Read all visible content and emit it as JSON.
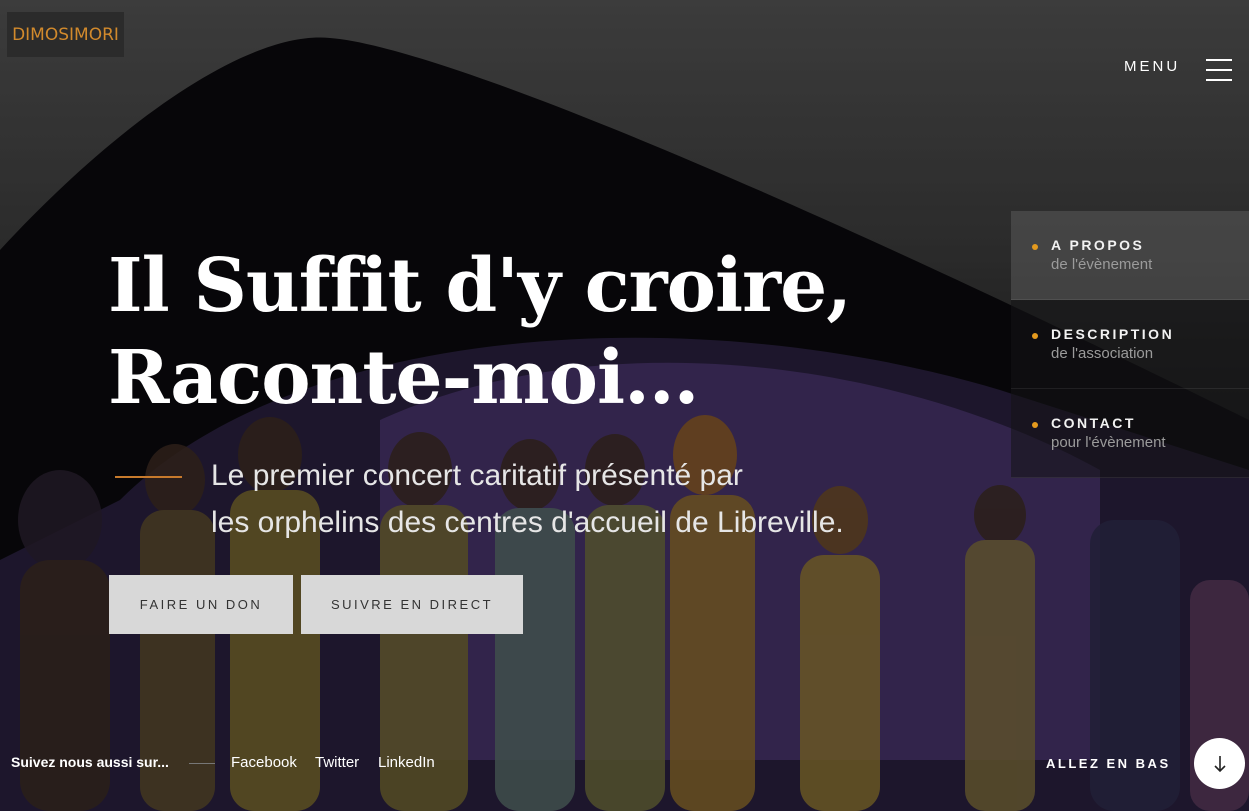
{
  "brand": {
    "logo_text": "DIMOSIMORI",
    "accent": "#e49a1e"
  },
  "menu": {
    "label": "MENU",
    "icon": "hamburger-icon"
  },
  "side_nav": [
    {
      "title": "A PROPOS",
      "subtitle": "de l'évènement",
      "active": true
    },
    {
      "title": "DESCRIPTION",
      "subtitle": "de l'association",
      "active": false
    },
    {
      "title": "CONTACT",
      "subtitle": "pour l'évènement",
      "active": false
    }
  ],
  "hero": {
    "headline_line1": "Il Suffit d'y croire,",
    "headline_line2": "Raconte-moi...",
    "subtitle_line1": "Le premier concert caritatif présenté par",
    "subtitle_line2": "les orphelins des centres d'accueil de Libreville."
  },
  "buttons": {
    "donate": "FAIRE UN DON",
    "live": "SUIVRE EN DIRECT"
  },
  "footer": {
    "follow_label": "Suivez nous aussi sur...",
    "social": [
      "Facebook",
      "Twitter",
      "LinkedIn"
    ],
    "scroll_label": "ALLEZ EN BAS",
    "scroll_icon": "arrow-down-icon"
  }
}
